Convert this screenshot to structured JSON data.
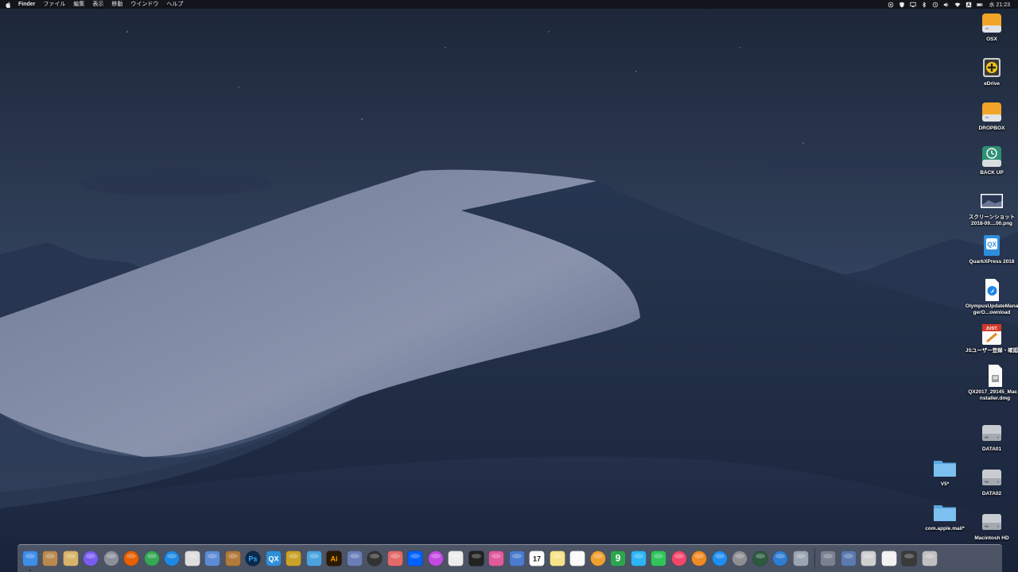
{
  "menubar": {
    "apple_icon": "apple-icon",
    "app_name": "Finder",
    "menus": [
      "ファイル",
      "編集",
      "表示",
      "移動",
      "ウインドウ",
      "ヘルプ"
    ],
    "clock": "水 21:23",
    "tray_icons": [
      "camera-icon",
      "shield-icon",
      "display-icon",
      "bluetooth-icon",
      "time-machine-icon",
      "volume-icon",
      "wifi-icon",
      "input-source-icon",
      "battery-icon"
    ]
  },
  "desktop": {
    "right_column": [
      {
        "label": "OSX",
        "icon": "drive-icon"
      },
      {
        "label": "eDrive",
        "icon": "edrive-icon"
      },
      {
        "label": "DROPBOX",
        "icon": "drive-icon"
      },
      {
        "label": "BACK UP",
        "icon": "time-machine-drive-icon"
      },
      {
        "label": "スクリーンショット 2018-09....00.png",
        "icon": "image-file-icon"
      },
      {
        "label": "QuarkXPress 2018",
        "icon": "quarkxpress-icon"
      },
      {
        "label": "OlympusUpdateManagerO...ownload",
        "icon": "safari-download-icon"
      },
      {
        "label": "JSユーザー登録・確認",
        "icon": "justsystems-icon"
      },
      {
        "label": "QX2017_29145_Mac_Installer.dmg",
        "icon": "dmg-file-icon"
      },
      {
        "label": "DATA01",
        "icon": "hard-drive-icon"
      },
      {
        "label": "DATA02",
        "icon": "hard-drive-icon"
      },
      {
        "label": "Macintosh HD",
        "icon": "hard-drive-icon"
      }
    ],
    "left_column": [
      {
        "label": "V5*",
        "icon": "folder-icon"
      },
      {
        "label": "com.apple.mail*",
        "icon": "folder-icon"
      }
    ]
  },
  "dock": {
    "apps": [
      {
        "name": "finder-icon",
        "color": "#3d8ee8",
        "running": true
      },
      {
        "name": "archive-utility-icon",
        "color": "#b98a4e",
        "running": false
      },
      {
        "name": "preview-icon",
        "color": "#d9b36a",
        "running": false
      },
      {
        "name": "siri-icon",
        "color": "#7a5cf0",
        "running": false
      },
      {
        "name": "launchpad-icon",
        "color": "#8a8f99",
        "running": false
      },
      {
        "name": "firefox-icon",
        "color": "#e66000",
        "running": false
      },
      {
        "name": "chrome-icon",
        "color": "#34a853",
        "running": false
      },
      {
        "name": "safari-icon",
        "color": "#1e88e5",
        "running": false
      },
      {
        "name": "script-editor-icon",
        "color": "#dddddd",
        "running": false
      },
      {
        "name": "photo-app-icon",
        "color": "#5b8bd4",
        "running": false
      },
      {
        "name": "notebook-icon",
        "color": "#b07a3a",
        "running": false
      },
      {
        "name": "photoshop-icon",
        "color": "#0b2a4a",
        "running": false
      },
      {
        "name": "quarkxpress-icon",
        "color": "#2f8fd8",
        "running": false
      },
      {
        "name": "scanner-icon",
        "color": "#c9a227",
        "running": false
      },
      {
        "name": "pen-tool-icon",
        "color": "#4aa3df",
        "running": false
      },
      {
        "name": "illustrator-icon",
        "color": "#2a1a00",
        "running": false
      },
      {
        "name": "vortex-icon",
        "color": "#6a7fb8",
        "running": false
      },
      {
        "name": "lens-icon",
        "color": "#333333",
        "running": false
      },
      {
        "name": "flamingo-icon",
        "color": "#e46a6a",
        "running": false
      },
      {
        "name": "dropbox-icon",
        "color": "#0061fe",
        "running": false
      },
      {
        "name": "media-player-icon",
        "color": "#c34ae0",
        "running": false
      },
      {
        "name": "bag-icon",
        "color": "#ececec",
        "running": false
      },
      {
        "name": "final-cut-icon",
        "color": "#222222",
        "running": false
      },
      {
        "name": "color-app-icon",
        "color": "#e05a9c",
        "running": false
      },
      {
        "name": "mail-icon",
        "color": "#4a7bd0",
        "running": false
      },
      {
        "name": "calendar-icon",
        "color": "#ffffff",
        "running": false
      },
      {
        "name": "notes-icon",
        "color": "#f7e38b",
        "running": false
      },
      {
        "name": "reminders-icon",
        "color": "#fafafa",
        "running": false
      },
      {
        "name": "photos-icon",
        "color": "#f0a030",
        "running": false
      },
      {
        "name": "numbers-9-icon",
        "color": "#2ea44f",
        "running": false
      },
      {
        "name": "messages-icon",
        "color": "#2db5f5",
        "running": false
      },
      {
        "name": "facetime-icon",
        "color": "#30c45a",
        "running": false
      },
      {
        "name": "music-icon",
        "color": "#f2466b",
        "running": false
      },
      {
        "name": "books-icon",
        "color": "#f08a24",
        "running": false
      },
      {
        "name": "app-store-icon",
        "color": "#1f8ef1",
        "running": false
      },
      {
        "name": "system-preferences-icon",
        "color": "#8e8e93",
        "running": false
      },
      {
        "name": "radar-icon",
        "color": "#2d5a3d",
        "running": false
      },
      {
        "name": "globe-icon",
        "color": "#2e7dd1",
        "running": false
      },
      {
        "name": "migration-icon",
        "color": "#9aa4b2",
        "running": false
      }
    ],
    "others": [
      {
        "name": "utilities-icon",
        "color": "#7a8190"
      },
      {
        "name": "screenshot-stack-icon",
        "color": "#5a7ab0"
      },
      {
        "name": "disk-utility-icon",
        "color": "#cfcfcf"
      },
      {
        "name": "documents-stack-icon",
        "color": "#f2f2f2"
      },
      {
        "name": "downloads-stack-icon",
        "color": "#3a3a3a"
      },
      {
        "name": "trash-icon",
        "color": "#bfbfbf"
      }
    ]
  }
}
